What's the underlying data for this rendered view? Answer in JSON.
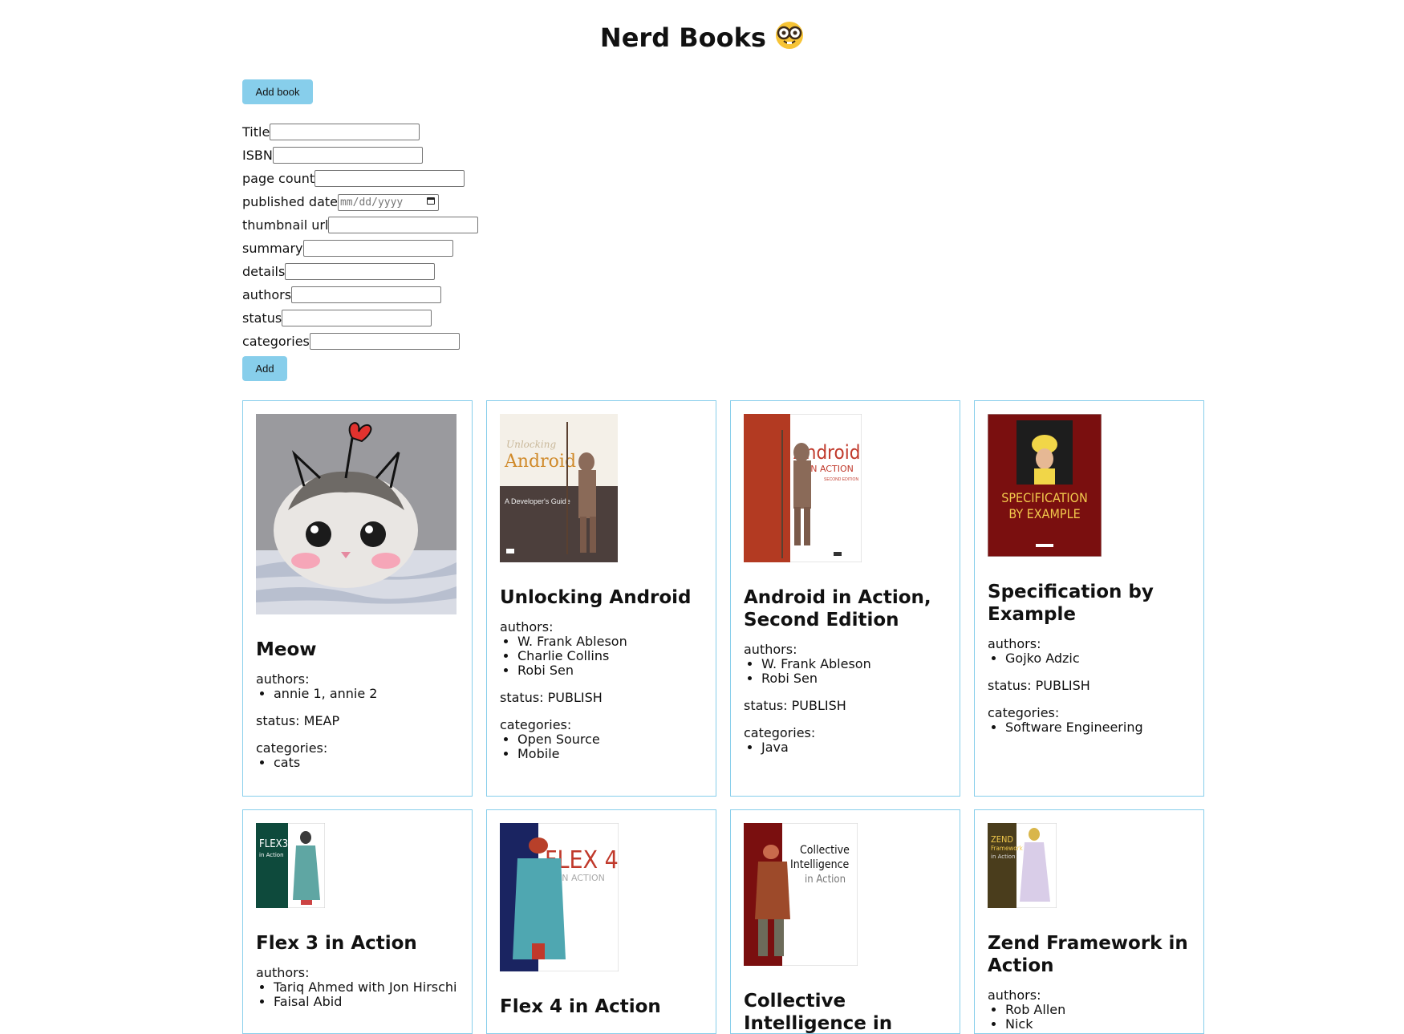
{
  "header": {
    "title": "Nerd Books",
    "emoji_icon": "nerd-face-icon"
  },
  "buttons": {
    "add_book": "Add book",
    "add": "Add"
  },
  "form": {
    "fields": [
      {
        "label": "Title",
        "value": ""
      },
      {
        "label": "ISBN",
        "value": ""
      },
      {
        "label": "page count",
        "value": ""
      },
      {
        "label": "published date",
        "placeholder": "mm/dd/yyyy"
      },
      {
        "label": "thumbnail url",
        "value": ""
      },
      {
        "label": "summary",
        "value": ""
      },
      {
        "label": "details",
        "value": ""
      },
      {
        "label": "authors",
        "value": ""
      },
      {
        "label": "status",
        "value": ""
      },
      {
        "label": "categories",
        "value": ""
      }
    ]
  },
  "labels": {
    "authors": "authors:",
    "categories": "categories:",
    "status_prefix": "status: "
  },
  "books": [
    {
      "title": "Meow",
      "authors": [
        "annie 1, annie 2"
      ],
      "status": "MEAP",
      "categories": [
        "cats"
      ],
      "cover": "cat-photo"
    },
    {
      "title": "Unlocking Android",
      "authors": [
        "W. Frank Ableson",
        "Charlie Collins",
        "Robi Sen"
      ],
      "status": "PUBLISH",
      "categories": [
        "Open Source",
        "Mobile"
      ],
      "cover": "unlocking-android-cover"
    },
    {
      "title": "Android in Action, Second Edition",
      "authors": [
        "W. Frank Ableson",
        "Robi Sen"
      ],
      "status": "PUBLISH",
      "categories": [
        "Java"
      ],
      "cover": "android-in-action-cover"
    },
    {
      "title": "Specification by Example",
      "authors": [
        "Gojko Adzic"
      ],
      "status": "PUBLISH",
      "categories": [
        "Software Engineering"
      ],
      "cover": "specification-by-example-cover"
    },
    {
      "title": "Flex 3 in Action",
      "authors": [
        "Tariq Ahmed with Jon Hirschi",
        "Faisal Abid"
      ],
      "status": "",
      "categories": [],
      "cover": "flex3-cover"
    },
    {
      "title": "Flex 4 in Action",
      "authors": [],
      "status": "",
      "categories": [],
      "cover": "flex4-cover"
    },
    {
      "title": "Collective Intelligence in Action",
      "authors": [],
      "status": "",
      "categories": [],
      "cover": "collective-intelligence-cover"
    },
    {
      "title": "Zend Framework in Action",
      "authors": [
        "Rob Allen",
        "Nick"
      ],
      "status": "",
      "categories": [],
      "cover": "zend-framework-cover"
    }
  ],
  "cover_text": {
    "unlocking": {
      "line1": "Unlocking",
      "line2": "Android",
      "line3": "A Developer's Guide"
    },
    "android": {
      "line1": "Android",
      "line2": "IN ACTION",
      "line3": "SECOND EDITION"
    },
    "spec": {
      "line1": "SPECIFICATION",
      "line2": "BY EXAMPLE"
    },
    "flex3": {
      "line1": "FLEX3",
      "line2": "in Action"
    },
    "flex4": {
      "line1": "FLEX 4",
      "line2": "IN ACTION"
    },
    "ci": {
      "line1": "Collective",
      "line2": "Intelligence",
      "line3": "in Action"
    },
    "zend": {
      "line1": "ZEND",
      "line2": "Framework",
      "line3": "in Action"
    }
  },
  "colors": {
    "accent": "#87ceeb",
    "card_border": "#87ceeb"
  }
}
